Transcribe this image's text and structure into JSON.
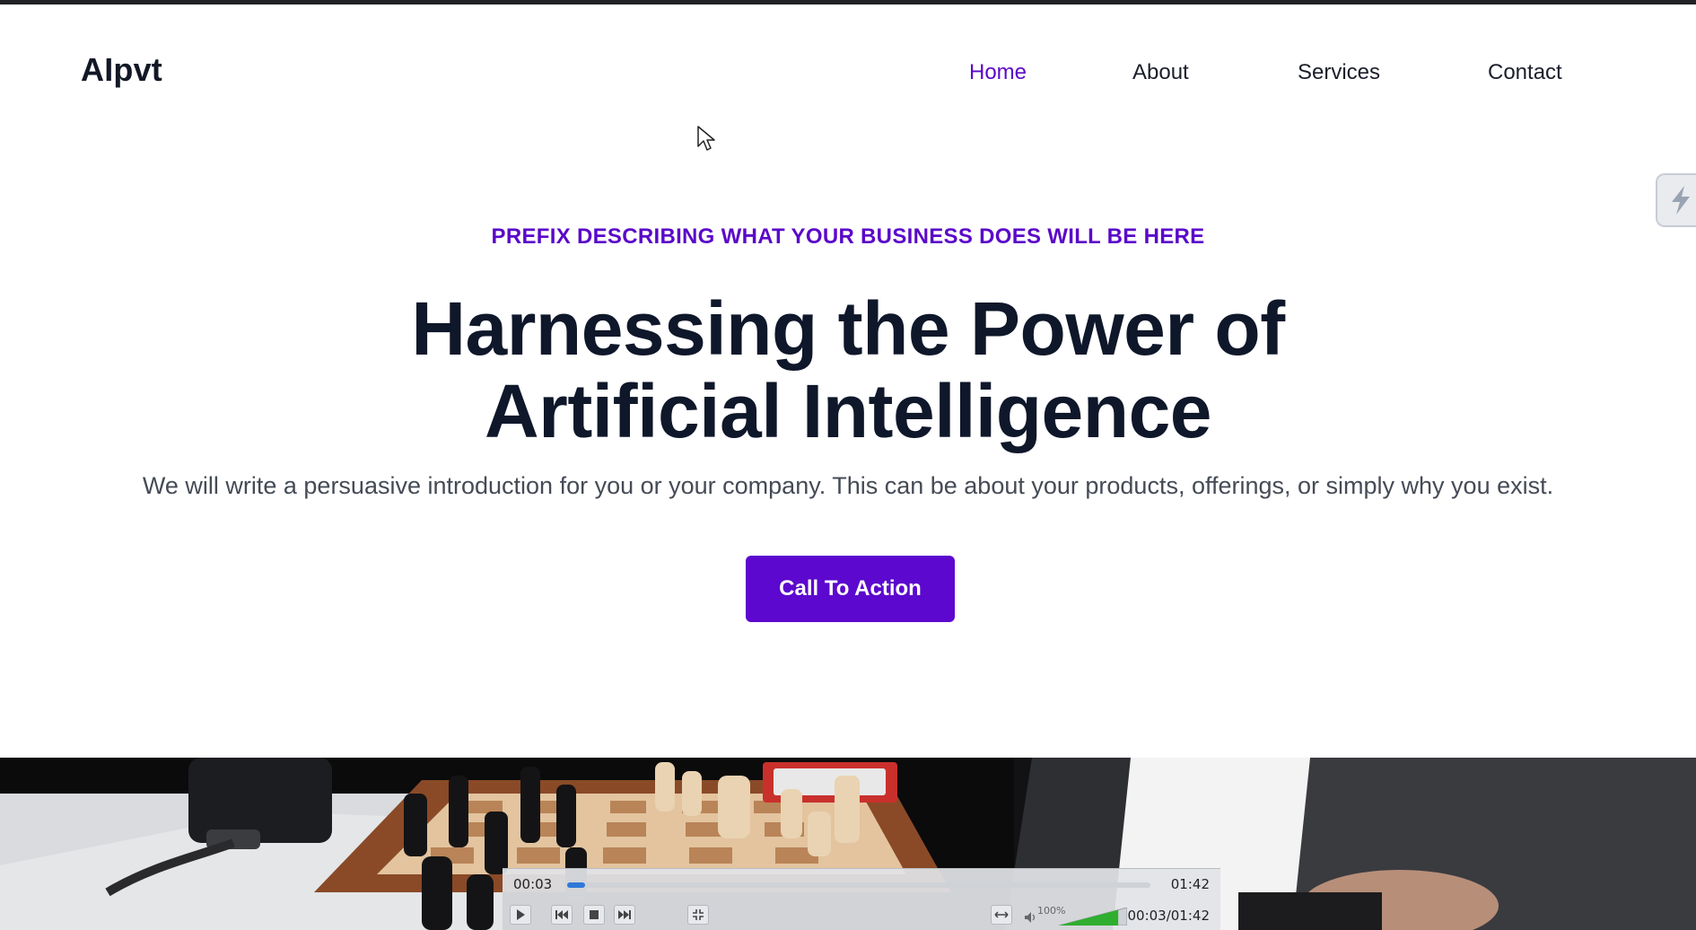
{
  "brand": {
    "logo": "AIpvt"
  },
  "nav": {
    "items": [
      {
        "label": "Home",
        "active": true
      },
      {
        "label": "About",
        "active": false
      },
      {
        "label": "Services",
        "active": false
      },
      {
        "label": "Contact",
        "active": false
      }
    ]
  },
  "hero": {
    "prefix": "PREFIX DESCRIBING WHAT YOUR BUSINESS DOES WILL BE HERE",
    "headline_line1": "Harnessing the Power of",
    "headline_line2": "Artificial Intelligence",
    "intro": "We will write a persuasive introduction for you or your company. This can be about your products, offerings, or simply why you exist.",
    "cta_label": "Call To Action"
  },
  "video_player": {
    "current_time": "00:03",
    "duration": "01:42",
    "combined_time": "00:03/01:42",
    "progress_fraction": 0.03,
    "volume_label": "100%",
    "volume_fraction": 1.0,
    "controls": [
      "play-icon",
      "previous-icon",
      "stop-icon",
      "next-icon",
      "fullscreen-icon",
      "aspect-icon",
      "speaker-icon"
    ]
  },
  "colors": {
    "accent": "#5c08ce",
    "heading": "#0f172a",
    "body_text": "#454b56",
    "top_strip": "#1f2124"
  },
  "widgets": {
    "side_widget_icon": "bolt-icon"
  }
}
